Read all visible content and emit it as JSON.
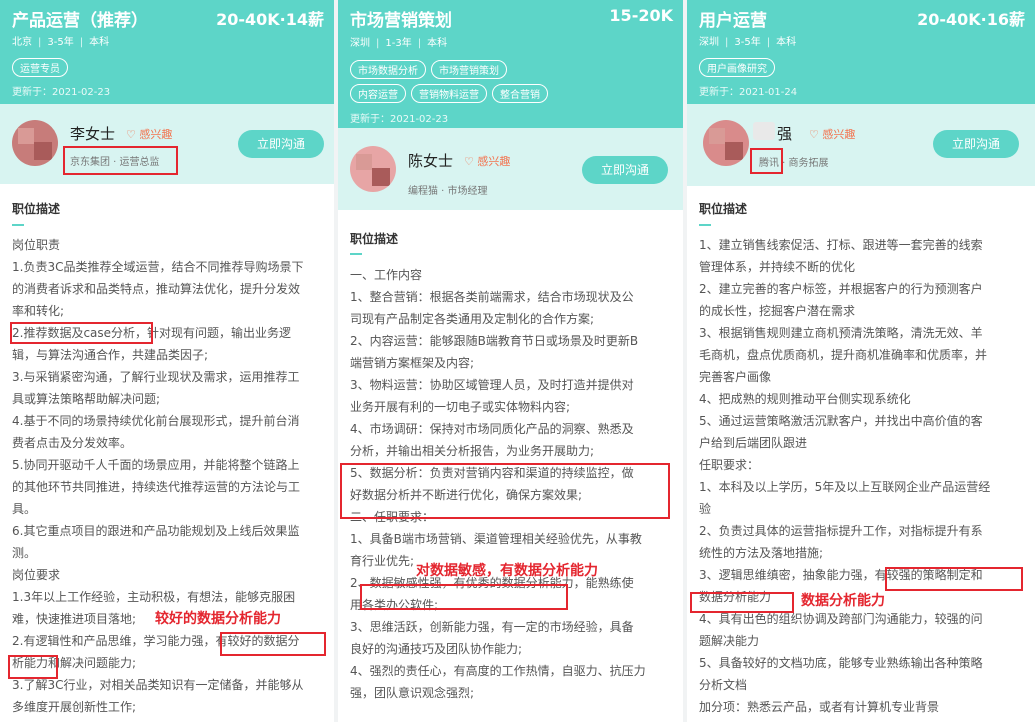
{
  "cards": [
    {
      "title": "产品运营（推荐）",
      "salary": "20-40K·14薪",
      "meta": [
        "北京",
        "3-5年",
        "本科"
      ],
      "tags": [
        "运营专员"
      ],
      "updated": "更新于：2021-02-23",
      "person": "李女士",
      "interest": "♡ 感兴趣",
      "company": "京东集团 · 运营总监",
      "chat": "立即沟通",
      "section": "职位描述",
      "lines": [
        "岗位职责",
        "1.负责3C品类推荐全域运营，结合不同推荐导购场景下",
        "的消费者诉求和品类特点，推动算法优化，提升分发效",
        "率和转化;",
        "2.推荐数据及case分析，针对现有问题，输出业务逻",
        "辑，与算法沟通合作，共建品类因子;",
        "3.与采销紧密沟通，了解行业现状及需求，运用推荐工",
        "具或算法策略帮助解决问题;",
        "4.基于不同的场景持续优化前台展现形式，提升前台消",
        "费者点击及分发效率。",
        "5.协同开驱动千人千面的场景应用，并能将整个链路上",
        "的其他环节共同推进，持续迭代推荐运营的方法论与工",
        "具。",
        "6.其它重点项目的跟进和产品功能规划及上线后效果监",
        "测。",
        "岗位要求",
        "1.3年以上工作经验，主动积极，有想法，能够克服困",
        "难，快速推进项目落地;",
        "2.有逻辑性和产品思维，学习能力强，有较好的数据分",
        "析能力和解决问题能力;",
        "3.了解3C行业，对相关品类知识有一定储备，并能够从",
        "多维度开展创新性工作;"
      ],
      "annotation": "较好的数据分析能力"
    },
    {
      "title": "市场营销策划",
      "salary": "15-20K",
      "meta": [
        "深圳",
        "1-3年",
        "本科"
      ],
      "tags": [
        "市场数据分析",
        "市场营销策划",
        "内容运营",
        "营销物料运营",
        "整合营销"
      ],
      "updated": "更新于：2021-02-23",
      "person": "陈女士",
      "interest": "♡ 感兴趣",
      "company": "编程猫 · 市场经理",
      "chat": "立即沟通",
      "section": "职位描述",
      "lines": [
        "一、工作内容",
        "1、整合营销：根据各类前端需求，结合市场现状及公",
        "司现有产品制定各类通用及定制化的合作方案;",
        "2、内容运营：能够跟随B端教育节日或场景及时更新B",
        "端营销方案框架及内容;",
        "3、物料运营：协助区域管理人员，及时打造并提供对",
        "业务开展有利的一切电子或实体物料内容;",
        "4、市场调研：保持对市场同质化产品的洞察、熟悉及",
        "分析，并输出相关分析报告，为业务开展助力;",
        "5、数据分析：负责对营销内容和渠道的持续监控，做",
        "好数据分析并不断进行优化，确保方案效果;",
        "二、任职要求：",
        "1、具备B端市场营销、渠道管理相关经验优先，从事教",
        "育行业优先;",
        "2、数据敏感性强，有优秀的数据分析能力，能熟练使",
        "用各类办公软件;",
        "3、思维活跃，创新能力强，有一定的市场经验，具备",
        "良好的沟通技巧及团队协作能力;",
        "4、强烈的责任心，有高度的工作热情，自驱力、抗压力",
        "强，团队意识观念强烈;"
      ],
      "annotation": "对数据敏感，有数据分析能力"
    },
    {
      "title": "用户运营",
      "salary": "20-40K·16薪",
      "meta": [
        "深圳",
        "3-5年",
        "本科"
      ],
      "tags": [
        "用户画像研究"
      ],
      "updated": "更新于：2021-01-24",
      "person": "强",
      "interest": "♡ 感兴趣",
      "company": "腾讯 · 商务拓展",
      "chat": "立即沟通",
      "section": "职位描述",
      "lines": [
        "1、建立销售线索促活、打标、跟进等一套完善的线索",
        "管理体系，并持续不断的优化",
        "2、建立完善的客户标签，并根据客户的行为预测客户",
        "的成长性，挖掘客户潜在需求",
        "3、根据销售规则建立商机预清洗策略，清洗无效、羊",
        "毛商机，盘点优质商机，提升商机准确率和优质率，并",
        "完善客户画像",
        "4、把成熟的规则推动平台侧实现系统化",
        "5、通过运营策略激活沉默客户，并找出中高价值的客",
        "户给到后端团队跟进",
        "任职要求：",
        "1、本科及以上学历，5年及以上互联网企业产品运营经",
        "验",
        "2、负责过具体的运营指标提升工作，对指标提升有系",
        "统性的方法及落地措施;",
        "3、逻辑思维缜密，抽象能力强，有较强的策略制定和",
        "数据分析能力",
        "4、具有出色的组织协调及跨部门沟通能力，较强的问",
        "题解决能力",
        "5、具备较好的文档功底，能够专业熟练输出各种策略",
        "分析文档",
        "加分项：熟悉云产品，或者有计算机专业背景"
      ],
      "annotation": "数据分析能力"
    }
  ]
}
